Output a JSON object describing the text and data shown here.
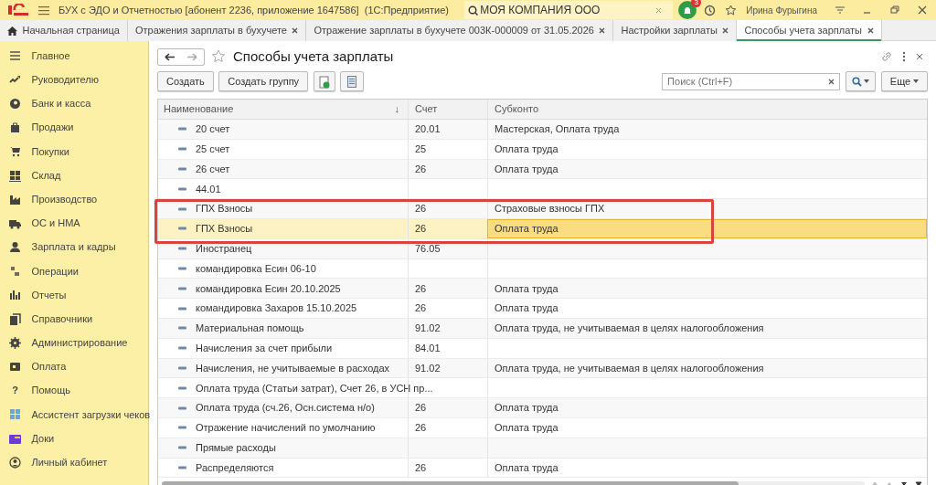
{
  "window": {
    "title": "БУХ с ЭДО и Отчетностью [абонент 2236, приложение 1647586]  (1С:Предприятие)",
    "company_search": {
      "value": "МОЯ КОМПАНИЯ ООО"
    },
    "notifications": "3",
    "user": "Ирина Фурыгина"
  },
  "tabs": [
    {
      "label": "Начальная страница",
      "kind": "home",
      "selected": false
    },
    {
      "label": "Отражения зарплаты в бухучете",
      "kind": "doc",
      "selected": false
    },
    {
      "label": "Отражение зарплаты в бухучете 003К-000009 от 31.05.2026",
      "kind": "doc",
      "selected": false
    },
    {
      "label": "Настройки зарплаты",
      "kind": "doc",
      "selected": false
    },
    {
      "label": "Способы учета зарплаты",
      "kind": "doc",
      "selected": true
    }
  ],
  "sidebar": {
    "items": [
      {
        "label": "Главное"
      },
      {
        "label": "Руководителю"
      },
      {
        "label": "Банк и касса"
      },
      {
        "label": "Продажи"
      },
      {
        "label": "Покупки"
      },
      {
        "label": "Склад"
      },
      {
        "label": "Производство"
      },
      {
        "label": "ОС и НМА"
      },
      {
        "label": "Зарплата и кадры"
      },
      {
        "label": "Операции"
      },
      {
        "label": "Отчеты"
      },
      {
        "label": "Справочники"
      },
      {
        "label": "Администрирование"
      },
      {
        "label": "Оплата"
      },
      {
        "label": "Помощь",
        "glyph": "?"
      },
      {
        "label": "Ассистент загрузки чеков"
      },
      {
        "label": "Доки"
      },
      {
        "label": "Личный кабинет"
      }
    ]
  },
  "form": {
    "title": "Способы учета зарплаты",
    "buttons": [
      "Создать",
      "Создать группу"
    ],
    "search": {
      "placeholder": "Поиск (Ctrl+F)"
    },
    "more": "Еще"
  },
  "table": {
    "columns": [
      {
        "label": "Наименование",
        "sort": "↓"
      },
      {
        "label": "Счет"
      },
      {
        "label": "Субконто"
      }
    ],
    "rows": [
      {
        "name": "20 счет",
        "account": "20.01",
        "subconto": "Мастерская, Оплата труда",
        "selected": false
      },
      {
        "name": "25 счет",
        "account": "25",
        "subconto": "Оплата труда",
        "selected": false
      },
      {
        "name": "26 счет",
        "account": "26",
        "subconto": "Оплата труда",
        "selected": false
      },
      {
        "name": "44.01",
        "account": "",
        "subconto": "",
        "selected": false
      },
      {
        "name": "ГПХ Взносы",
        "account": "26",
        "subconto": "Страховые взносы ГПХ",
        "selected": false
      },
      {
        "name": "ГПХ Взносы",
        "account": "26",
        "subconto": "Оплата труда",
        "selected": true
      },
      {
        "name": "Иностранец",
        "account": "76.05",
        "subconto": "",
        "selected": false
      },
      {
        "name": "командировка Есин 06-10",
        "account": "",
        "subconto": "",
        "selected": false
      },
      {
        "name": "командировка Есин 20.10.2025",
        "account": "26",
        "subconto": "Оплата труда",
        "selected": false
      },
      {
        "name": "командировка Захаров 15.10.2025",
        "account": "26",
        "subconto": "Оплата труда",
        "selected": false
      },
      {
        "name": "Материальная помощь",
        "account": "91.02",
        "subconto": "Оплата труда, не учитываемая в целях налогообложения",
        "selected": false
      },
      {
        "name": "Начисления за счет прибыли",
        "account": "84.01",
        "subconto": "",
        "selected": false
      },
      {
        "name": "Начисления, не учитываемые в расходах",
        "account": "91.02",
        "subconto": "Оплата труда, не учитываемая в целях налогообложения",
        "selected": false
      },
      {
        "name": "Оплата труда (Статьи затрат), Счет 26, в УСН пр...",
        "account": "",
        "subconto": "",
        "selected": false
      },
      {
        "name": "Оплата труда (сч.26, Осн.система н/о)",
        "account": "26",
        "subconto": "Оплата труда",
        "selected": false
      },
      {
        "name": "Отражение начислений по умолчанию",
        "account": "26",
        "subconto": "Оплата труда",
        "selected": false
      },
      {
        "name": "Прямые расходы",
        "account": "",
        "subconto": "",
        "selected": false
      },
      {
        "name": "Распределяются",
        "account": "26",
        "subconto": "Оплата труда",
        "selected": false
      }
    ]
  }
}
